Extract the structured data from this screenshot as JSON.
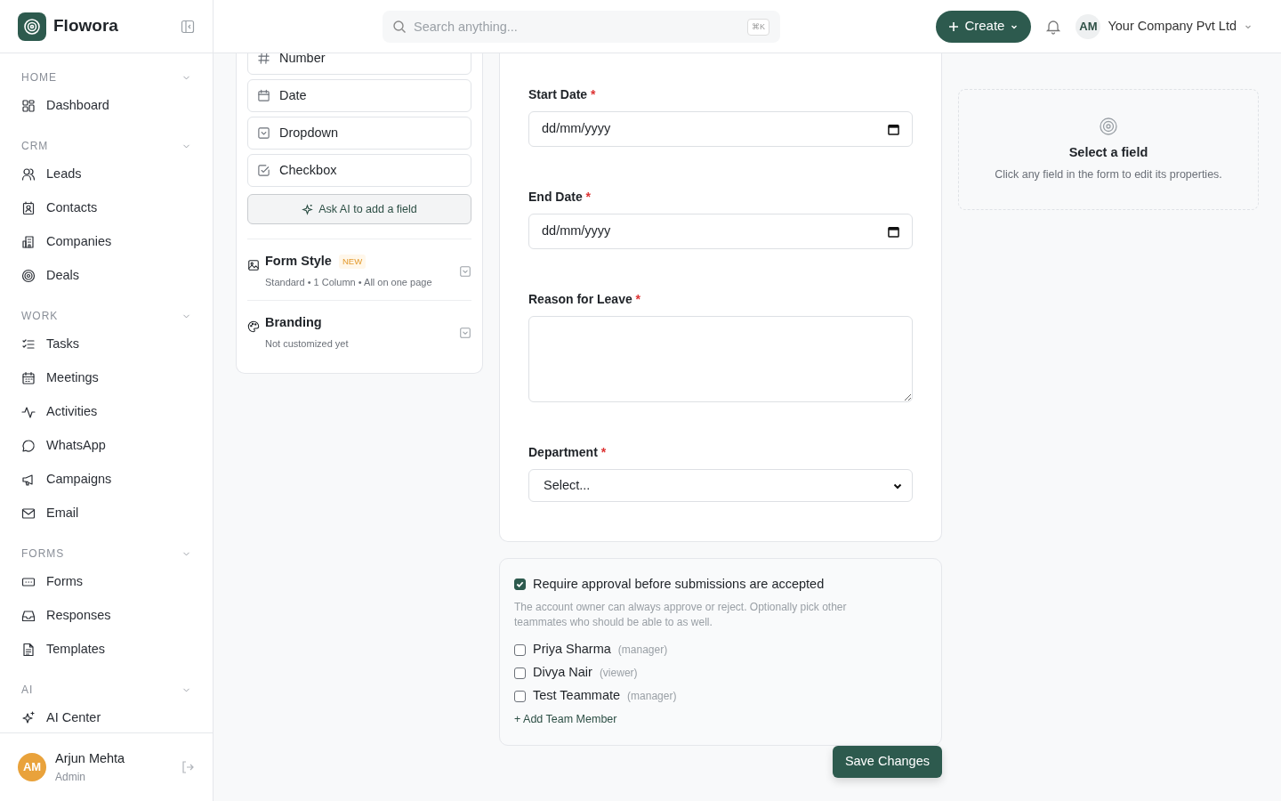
{
  "app": {
    "name": "Flowora"
  },
  "search": {
    "placeholder": "Search anything...",
    "shortcut": "⌘K"
  },
  "header": {
    "create_label": "Create",
    "company_initials": "AM",
    "company": "Your Company Pvt Ltd"
  },
  "sidebar": {
    "sections": [
      {
        "label": "HOME",
        "expanded": true,
        "items": [
          {
            "label": "Dashboard"
          }
        ]
      },
      {
        "label": "CRM",
        "expanded": true,
        "items": [
          {
            "label": "Leads"
          },
          {
            "label": "Contacts"
          },
          {
            "label": "Companies"
          },
          {
            "label": "Deals"
          }
        ]
      },
      {
        "label": "WORK",
        "expanded": true,
        "items": [
          {
            "label": "Tasks"
          },
          {
            "label": "Meetings"
          },
          {
            "label": "Activities"
          },
          {
            "label": "WhatsApp"
          },
          {
            "label": "Campaigns"
          },
          {
            "label": "Email"
          }
        ]
      },
      {
        "label": "FORMS",
        "expanded": true,
        "items": [
          {
            "label": "Forms"
          },
          {
            "label": "Responses"
          },
          {
            "label": "Templates"
          }
        ]
      },
      {
        "label": "AI",
        "expanded": true,
        "items": [
          {
            "label": "AI Center"
          }
        ]
      }
    ]
  },
  "user": {
    "initials": "AM",
    "name": "Arjun Mehta",
    "role": "Admin"
  },
  "field_palette": {
    "items": [
      {
        "label": "Number"
      },
      {
        "label": "Date"
      },
      {
        "label": "Dropdown"
      },
      {
        "label": "Checkbox"
      }
    ],
    "ai_button": "Ask AI to add a field"
  },
  "settings": [
    {
      "title": "Form Style",
      "badge": "NEW",
      "summary": "Standard • 1 Column • All on one page"
    },
    {
      "title": "Branding",
      "summary": "Not customized yet"
    }
  ],
  "form": {
    "required_mark": "*",
    "fields": [
      {
        "kind": "date",
        "label": "Start Date",
        "required": true,
        "placeholder": "dd/mm/yyyy"
      },
      {
        "kind": "date",
        "label": "End Date",
        "required": true,
        "placeholder": "dd/mm/yyyy"
      },
      {
        "kind": "textarea",
        "label": "Reason for Leave",
        "required": true
      },
      {
        "kind": "select",
        "label": "Department",
        "required": true,
        "value": "Select..."
      }
    ]
  },
  "approval": {
    "checked": true,
    "label": "Require approval before submissions are accepted",
    "hint": "The account owner can always approve or reject. Optionally pick other teammates who should be able to as well.",
    "teammates": [
      {
        "name": "Priya Sharma",
        "role": "(manager)",
        "checked": false
      },
      {
        "name": "Divya Nair",
        "role": "(viewer)",
        "checked": false
      },
      {
        "name": "Test Teammate",
        "role": "(manager)",
        "checked": false
      }
    ],
    "add_link": "+ Add Team Member"
  },
  "save_button": "Save Changes",
  "properties": {
    "title": "Select a field",
    "hint": "Click any field in the form to edit its properties."
  }
}
